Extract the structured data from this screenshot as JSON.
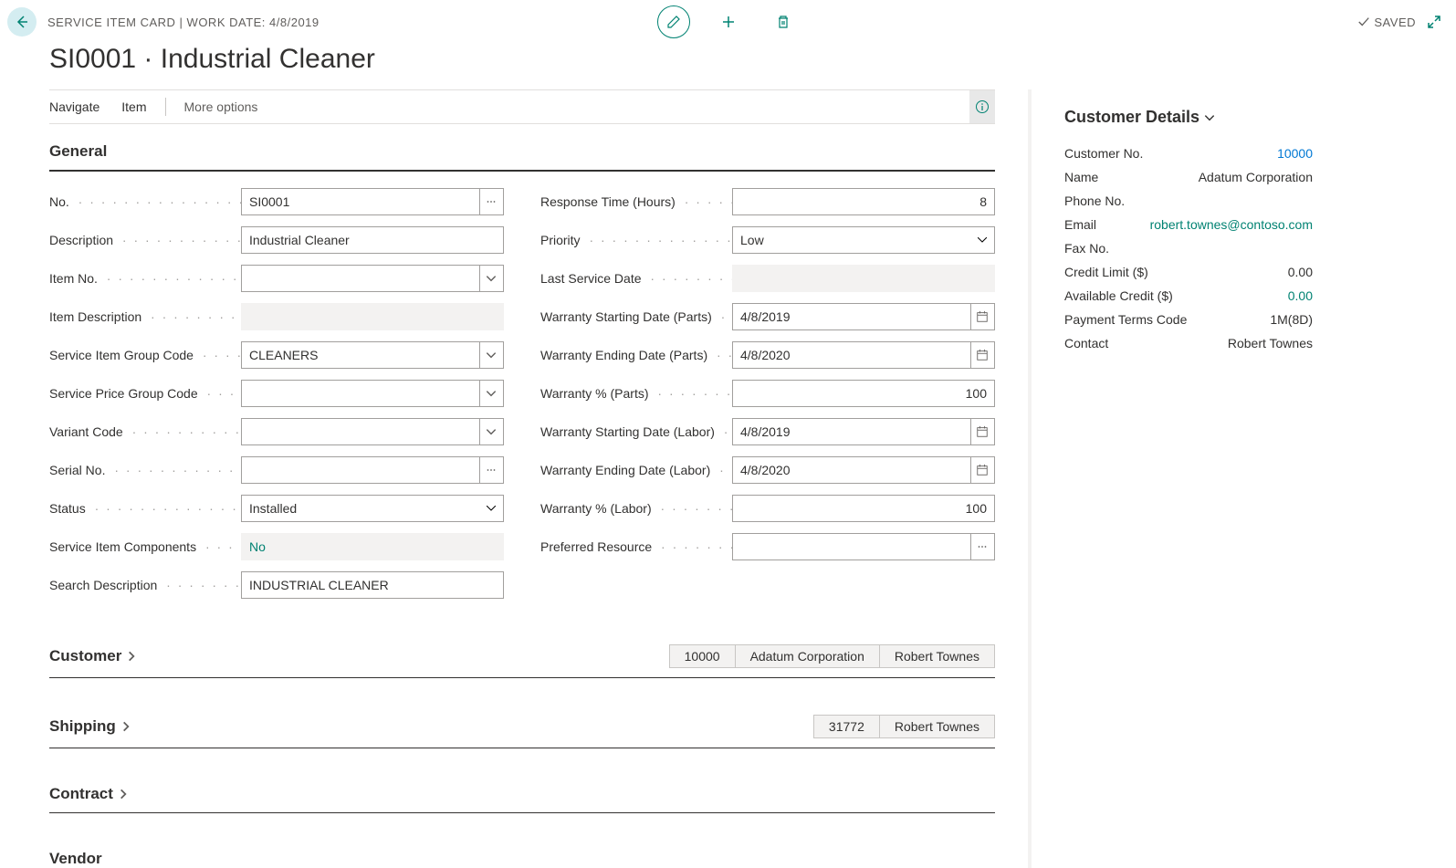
{
  "header": {
    "breadcrumb": "SERVICE ITEM CARD | WORK DATE: 4/8/2019",
    "saved": "SAVED",
    "title": "SI0001 · Industrial Cleaner"
  },
  "nav": {
    "navigate": "Navigate",
    "item": "Item",
    "more": "More options"
  },
  "sections": {
    "general": "General",
    "customer": "Customer",
    "shipping": "Shipping",
    "contract": "Contract",
    "vendor": "Vendor"
  },
  "general": {
    "left": {
      "no_label": "No.",
      "no_value": "SI0001",
      "description_label": "Description",
      "description_value": "Industrial Cleaner",
      "item_no_label": "Item No.",
      "item_no_value": "",
      "item_desc_label": "Item Description",
      "item_desc_value": "",
      "service_item_group_label": "Service Item Group Code",
      "service_item_group_value": "CLEANERS",
      "service_price_group_label": "Service Price Group Code",
      "service_price_group_value": "",
      "variant_code_label": "Variant Code",
      "variant_code_value": "",
      "serial_no_label": "Serial No.",
      "serial_no_value": "",
      "status_label": "Status",
      "status_value": "Installed",
      "components_label": "Service Item Components",
      "components_value": "No",
      "search_desc_label": "Search Description",
      "search_desc_value": "INDUSTRIAL CLEANER"
    },
    "right": {
      "response_time_label": "Response Time (Hours)",
      "response_time_value": "8",
      "priority_label": "Priority",
      "priority_value": "Low",
      "last_service_label": "Last Service Date",
      "last_service_value": "",
      "warranty_start_parts_label": "Warranty Starting Date (Parts)",
      "warranty_start_parts_value": "4/8/2019",
      "warranty_end_parts_label": "Warranty Ending Date (Parts)",
      "warranty_end_parts_value": "4/8/2020",
      "warranty_pct_parts_label": "Warranty % (Parts)",
      "warranty_pct_parts_value": "100",
      "warranty_start_labor_label": "Warranty Starting Date (Labor)",
      "warranty_start_labor_value": "4/8/2019",
      "warranty_end_labor_label": "Warranty Ending Date (Labor)",
      "warranty_end_labor_value": "4/8/2020",
      "warranty_pct_labor_label": "Warranty % (Labor)",
      "warranty_pct_labor_value": "100",
      "preferred_resource_label": "Preferred Resource",
      "preferred_resource_value": ""
    }
  },
  "customer_summary": {
    "v1": "10000",
    "v2": "Adatum Corporation",
    "v3": "Robert Townes"
  },
  "shipping_summary": {
    "v1": "31772",
    "v2": "Robert Townes"
  },
  "side": {
    "title": "Customer Details",
    "customer_no_label": "Customer No.",
    "customer_no_value": "10000",
    "name_label": "Name",
    "name_value": "Adatum Corporation",
    "phone_label": "Phone No.",
    "phone_value": "",
    "email_label": "Email",
    "email_value": "robert.townes@contoso.com",
    "fax_label": "Fax No.",
    "fax_value": "",
    "credit_limit_label": "Credit Limit ($)",
    "credit_limit_value": "0.00",
    "available_credit_label": "Available Credit ($)",
    "available_credit_value": "0.00",
    "payment_terms_label": "Payment Terms Code",
    "payment_terms_value": "1M(8D)",
    "contact_label": "Contact",
    "contact_value": "Robert Townes"
  }
}
